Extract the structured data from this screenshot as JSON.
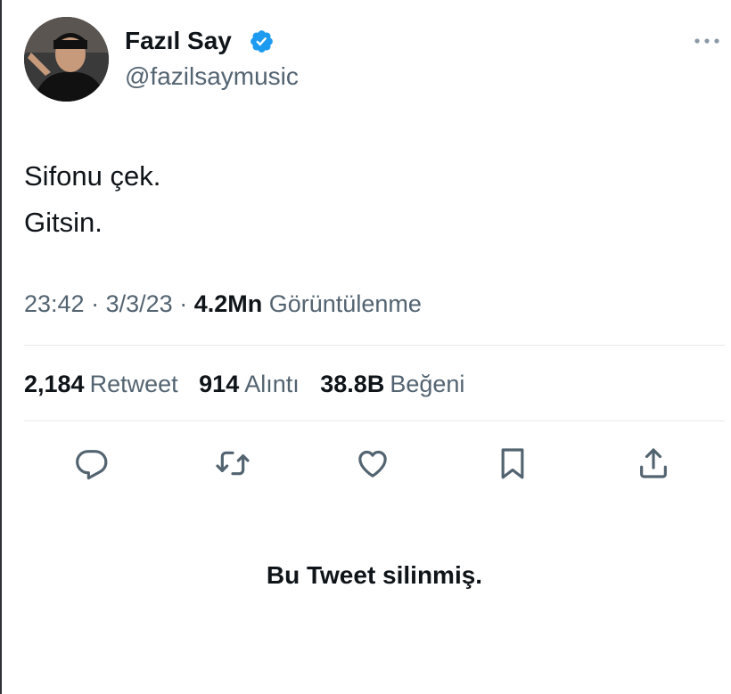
{
  "author": {
    "display_name": "Fazıl Say",
    "handle": "@fazilsaymusic",
    "verified": true,
    "verified_color": "#1d9bf0"
  },
  "tweet": {
    "lines": [
      "Sifonu çek.",
      "Gitsin."
    ]
  },
  "meta": {
    "time": "23:42",
    "separator": "·",
    "date": "3/3/23",
    "views_count": "4.2Mn",
    "views_label": "Görüntülenme"
  },
  "stats": {
    "retweets": {
      "count": "2,184",
      "label": "Retweet"
    },
    "quotes": {
      "count": "914",
      "label": "Alıntı"
    },
    "likes": {
      "count": "38.8B",
      "label": "Beğeni"
    }
  },
  "actions": [
    {
      "name": "reply-icon"
    },
    {
      "name": "retweet-icon"
    },
    {
      "name": "like-icon"
    },
    {
      "name": "bookmark-icon"
    },
    {
      "name": "share-icon"
    }
  ],
  "deleted_notice": "Bu Tweet silinmiş.",
  "colors": {
    "text": "#0f1419",
    "secondary": "#536471",
    "divider": "#e4e8eb"
  }
}
